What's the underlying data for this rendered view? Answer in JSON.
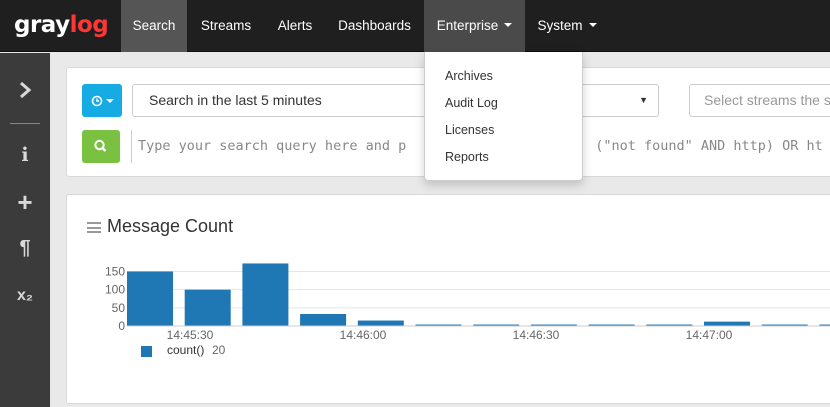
{
  "brand": {
    "logo_gray": "gray",
    "logo_log": "log"
  },
  "nav": {
    "search": "Search",
    "streams": "Streams",
    "alerts": "Alerts",
    "dashboards": "Dashboards",
    "enterprise": "Enterprise",
    "system": "System"
  },
  "enterprise_menu": [
    "Archives",
    "Audit Log",
    "Licenses",
    "Reports"
  ],
  "sidebar": {
    "icons": [
      "chevron-right-icon",
      "info-icon",
      "plus-icon",
      "paragraph-icon",
      "subscript-icon"
    ],
    "info": "i",
    "plus": "+",
    "paragraph": "¶",
    "subscript": "x₂"
  },
  "search": {
    "range_value": "Search in the last 5 minutes",
    "streams_placeholder": "Select streams the s",
    "query_placeholder": "Type your search query here and p"
  },
  "query_suffix_visible": "(\"not found\" AND http) OR ht",
  "widget": {
    "title": "Message Count",
    "legend_label": "count()",
    "legend_value": "20"
  },
  "colors": {
    "navbar": "#1f1f1f",
    "sidebar": "#3b3b3b",
    "time_button": "#16ace3",
    "search_button": "#7ac142",
    "bar": "#1f77b4",
    "logo_accent": "#ff3633"
  },
  "chart_data": {
    "type": "bar",
    "title": "Message Count",
    "y_ticks": [
      "150",
      "100",
      "50",
      "0"
    ],
    "ylim": [
      0,
      165
    ],
    "x_ticks": [
      "14:45:30",
      "14:46:00",
      "14:46:30",
      "14:47:00"
    ],
    "series": [
      {
        "name": "count()",
        "values": [
          150,
          100,
          172,
          33,
          15,
          4,
          4,
          4,
          4,
          4,
          12,
          4,
          4
        ]
      }
    ]
  }
}
